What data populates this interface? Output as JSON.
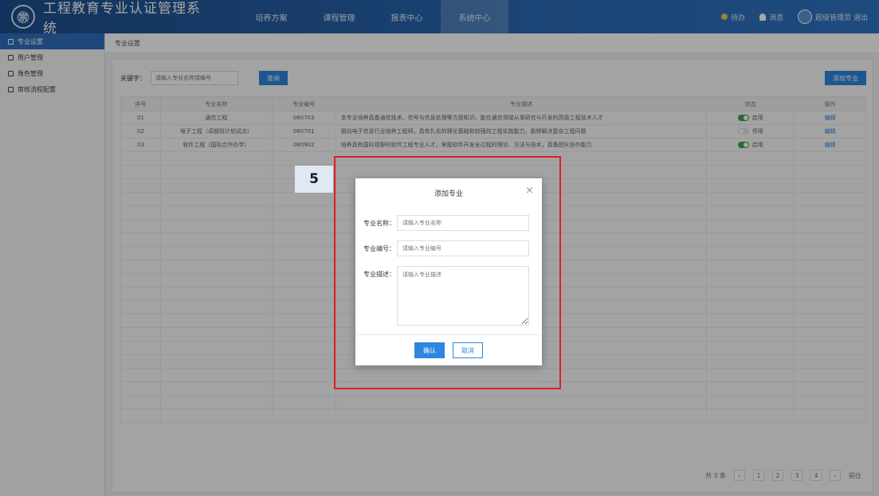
{
  "header": {
    "logo_glyph": "㊪",
    "title": "工程教育专业认证管理系统",
    "tabs": [
      "培养方案",
      "课程管理",
      "报表中心",
      "系统中心"
    ],
    "active_tab_index": 3,
    "right": {
      "notice": "待办",
      "messages": "消息",
      "user": "超级管理员 退出"
    }
  },
  "sidebar": {
    "items": [
      {
        "label": "专业设置",
        "active": true
      },
      {
        "label": "用户管理",
        "active": false
      },
      {
        "label": "角色管理",
        "active": false
      },
      {
        "label": "审核流程配置",
        "active": false
      }
    ]
  },
  "breadcrumb": "专业设置",
  "toolbar": {
    "keyword_label": "关键字：",
    "search_placeholder": "请输入专业名称或编号",
    "search_button": "查询",
    "add_button": "添加专业"
  },
  "table": {
    "columns": [
      "序号",
      "专业名称",
      "专业编号",
      "专业描述",
      "状态",
      "操作"
    ],
    "rows": [
      {
        "no": "01",
        "name": "通信工程",
        "code": "080703",
        "desc": "本专业培养具备通信技术、信号与信息处理等方面知识，能在通信领域从事研究与开发的高级工程技术人才",
        "status": "启用",
        "on": true,
        "op": "编辑"
      },
      {
        "no": "02",
        "name": "电子工程（卓越班计划试点）",
        "code": "080701",
        "desc": "面向电子信息行业培养工程师，具有扎实的理论基础和较强的工程实践能力，能够解决复杂工程问题",
        "status": "停用",
        "on": false,
        "op": "编辑"
      },
      {
        "no": "03",
        "name": "软件工程（国际合作办学）",
        "code": "080902",
        "desc": "培养具有国际视野的软件工程专业人才，掌握软件开发全过程的理论、方法与技术，具备团队协作能力",
        "status": "启用",
        "on": true,
        "op": "编辑"
      }
    ]
  },
  "pager": {
    "total": "共 3 条",
    "pages": [
      "1",
      "2",
      "3",
      "4"
    ],
    "goto": "前往"
  },
  "modal": {
    "title": "添加专业",
    "close_icon": "×",
    "fields": [
      {
        "label": "专业名称：",
        "placeholder": "请输入专业名称"
      },
      {
        "label": "专业编号：",
        "placeholder": "请输入专业编号"
      },
      {
        "label": "专业描述：",
        "placeholder": "请输入专业描述"
      }
    ],
    "confirm": "确认",
    "cancel": "取消"
  },
  "annotation": {
    "step": "5",
    "box_color": "#e02020"
  },
  "colors": {
    "header_blue": "#2a6ab5",
    "accent_blue": "#2e86de",
    "switch_on": "#3aa84a"
  }
}
